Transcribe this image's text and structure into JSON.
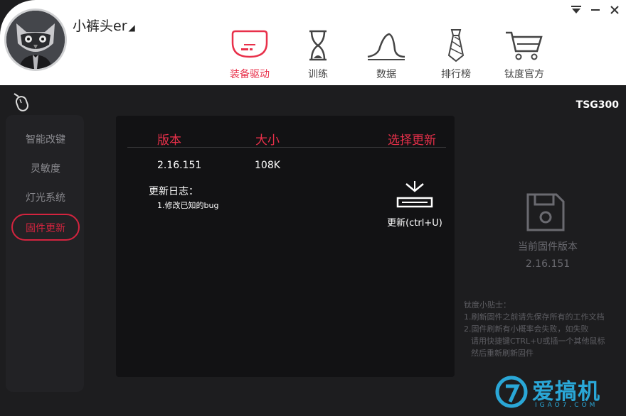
{
  "header": {
    "username": "小裤头er",
    "nav": [
      {
        "label": "装备驱动",
        "icon": "driver-icon",
        "active": true
      },
      {
        "label": "训练",
        "icon": "hourglass-icon"
      },
      {
        "label": "数据",
        "icon": "data-curve-icon"
      },
      {
        "label": "排行榜",
        "icon": "tie-icon"
      },
      {
        "label": "钛度官方",
        "icon": "cart-icon"
      }
    ]
  },
  "model": "TSG300",
  "sidebar": {
    "items": [
      {
        "label": "智能改键"
      },
      {
        "label": "灵敏度"
      },
      {
        "label": "灯光系统"
      },
      {
        "label": "固件更新",
        "active": true
      }
    ]
  },
  "panel": {
    "columns": [
      "版本",
      "大小",
      "选择更新"
    ],
    "row": {
      "version": "2.16.151",
      "size": "108K"
    },
    "changelog_title": "更新日志：",
    "changelog_lines": [
      "1.修改已知的bug"
    ],
    "update_label": "更新(ctrl+U)"
  },
  "firmware": {
    "title": "当前固件版本",
    "version": "2.16.151"
  },
  "tips": {
    "title": "钛度小贴士：",
    "lines": [
      "1.刷新固件之前请先保存所有的工作文档",
      "2.固件刷新有小概率会失败，如失败",
      "请用快捷键CTRL+U或插一个其他鼠标",
      "然后重新刷新固件"
    ]
  },
  "logo": {
    "text": "爱搞机",
    "sub": "IGAO7.COM"
  },
  "colors": {
    "accent": "#e8304a",
    "background": "#1d1d1f",
    "panel": "#121214",
    "logo": "#2aa7d7"
  }
}
